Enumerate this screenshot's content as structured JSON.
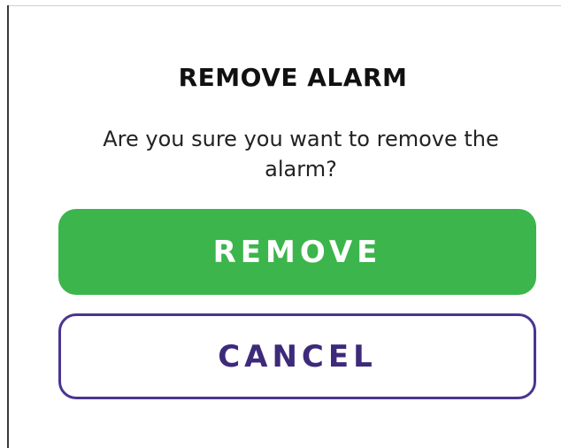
{
  "dialog": {
    "title": "REMOVE ALARM",
    "message": "Are you sure you want to remove the alarm?",
    "remove_label": "REMOVE",
    "cancel_label": "CANCEL"
  },
  "colors": {
    "remove_background": "#3cb54c",
    "remove_text": "#ffffff",
    "cancel_border": "#4a3590",
    "cancel_text": "#3d2a7a",
    "title_text": "#111111"
  }
}
